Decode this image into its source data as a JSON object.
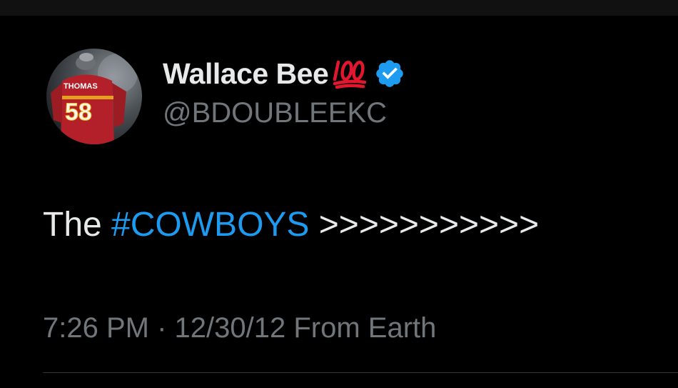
{
  "tweet": {
    "author": {
      "display_name": "Wallace Bee",
      "name_emoji": "hundred-points-emoji",
      "handle": "@BDOUBLEEKC",
      "verified": true,
      "avatar": {
        "jersey_name": "THOMAS",
        "jersey_number": "58"
      }
    },
    "text_prefix": "The ",
    "hashtag": "#COWBOYS",
    "text_suffix": " >>>>>>>>>>>",
    "time": "7:26 PM",
    "separator": " · ",
    "date": "12/30/12",
    "source": " From Earth"
  },
  "colors": {
    "background": "#000000",
    "text": "#e7e9ea",
    "secondary": "#71767b",
    "link": "#1d9bf0",
    "verified_badge": "#1d9bf0",
    "emoji_red": "#e0172f",
    "divider": "#2f3336"
  }
}
